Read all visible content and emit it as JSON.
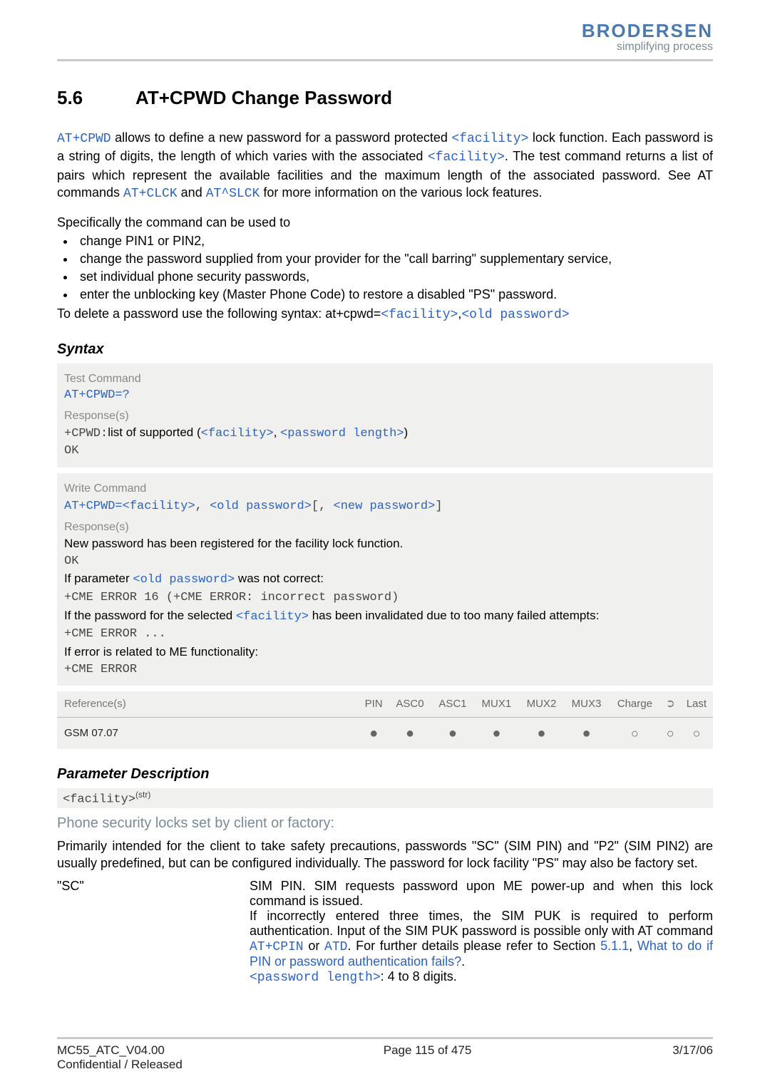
{
  "header": {
    "brand": "BRODERSEN",
    "tagline": "simplifying process"
  },
  "title": {
    "number": "5.6",
    "text": "AT+CPWD   Change Password"
  },
  "intro": {
    "cmd1": "AT+CPWD",
    "t1a": " allows to define a new password for a password protected ",
    "fac1": "<facility>",
    "t1b": " lock function. Each password is a string of digits, the length of which varies with the associated ",
    "fac2": "<facility>",
    "t1c": ". The test command returns a list of pairs which represent the available facilities and the maximum length of the associated password. See AT commands ",
    "cmd2": "AT+CLCK",
    "t1d": " and ",
    "cmd3": "AT^SLCK",
    "t1e": " for more information on the various lock features."
  },
  "spec_intro": "Specifically the command can be used to",
  "bullets": [
    "change PIN1 or PIN2,",
    "change the password supplied from your provider for the \"call barring\" supplementary service,",
    "set individual phone security passwords,",
    "enter the unblocking key (Master Phone Code) to restore a disabled \"PS\" password."
  ],
  "delete_line": {
    "pre": "To delete a password use the following syntax: at+cpwd=",
    "fac": "<facility>",
    "sep": ",",
    "old": "<old password>"
  },
  "syntax_heading": "Syntax",
  "syntax": {
    "test_label": "Test Command",
    "test_cmd": "AT+CPWD=?",
    "resp_label": "Response(s)",
    "test_resp_pre": "+CPWD:",
    "test_resp_mid": "list of supported (",
    "test_resp_fac": "<facility>",
    "test_resp_sep": ", ",
    "test_resp_len": "<password length>",
    "test_resp_post": ")",
    "ok": "OK",
    "write_label": "Write Command",
    "write_cmd_pre": "AT+CPWD=",
    "write_fac": "<facility>",
    "write_sep1": ", ",
    "write_old": "<old password>",
    "write_sep2": "[, ",
    "write_new": "<new password>",
    "write_sep3": "]",
    "write_resp1": "New password has been registered for the facility lock function.",
    "write_if1a": "If parameter ",
    "write_if1_old": "<old password>",
    "write_if1b": " was not correct:",
    "write_err1": "+CME ERROR 16 (+CME ERROR: incorrect password)",
    "write_if2a": "If the password for the selected ",
    "write_if2_fac": "<facility>",
    "write_if2b": " has been invalidated due to too many failed attempts:",
    "write_err2": "+CME ERROR ...",
    "write_if3": "If error is related to ME functionality:",
    "write_err3": "+CME ERROR"
  },
  "ref": {
    "refs_label": "Reference(s)",
    "refs_value": "GSM 07.07",
    "cols": [
      "PIN",
      "ASC0",
      "ASC1",
      "MUX1",
      "MUX2",
      "MUX3",
      "Charge",
      "",
      "Last"
    ],
    "vals": [
      "●",
      "●",
      "●",
      "●",
      "●",
      "●",
      "○",
      "○",
      "○"
    ]
  },
  "param_heading": "Parameter Description",
  "param": {
    "name": "<facility>",
    "sup": "(str)",
    "subtitle": "Phone security locks set by client or factory:",
    "desc": "Primarily intended for the client to take safety precautions, passwords \"SC\" (SIM PIN) and \"P2\" (SIM PIN2) are usually predefined, but can be configured individually. The password for lock facility \"PS\" may also be factory set.",
    "sc_key": "\"SC\"",
    "sc_l1": "SIM PIN. SIM requests password upon ME power-up and when this lock command is issued.",
    "sc_l2a": "If incorrectly entered three times, the SIM PUK is required to perform authentication. Input of the SIM PUK password is possible only with AT command ",
    "sc_cmd1": "AT+CPIN",
    "sc_or": " or ",
    "sc_cmd2": "ATD",
    "sc_l2b": ". For further details please refer to Section ",
    "sc_sec": "5.1.1",
    "sc_sep": ", ",
    "sc_link": "What to do if PIN or password authentication fails?",
    "sc_dot": ".",
    "sc_len": "<password length>",
    "sc_len_t": ": 4 to 8 digits."
  },
  "footer": {
    "left1": "MC55_ATC_V04.00",
    "left2": "Confidential / Released",
    "center": "Page 115 of 475",
    "right": "3/17/06"
  }
}
